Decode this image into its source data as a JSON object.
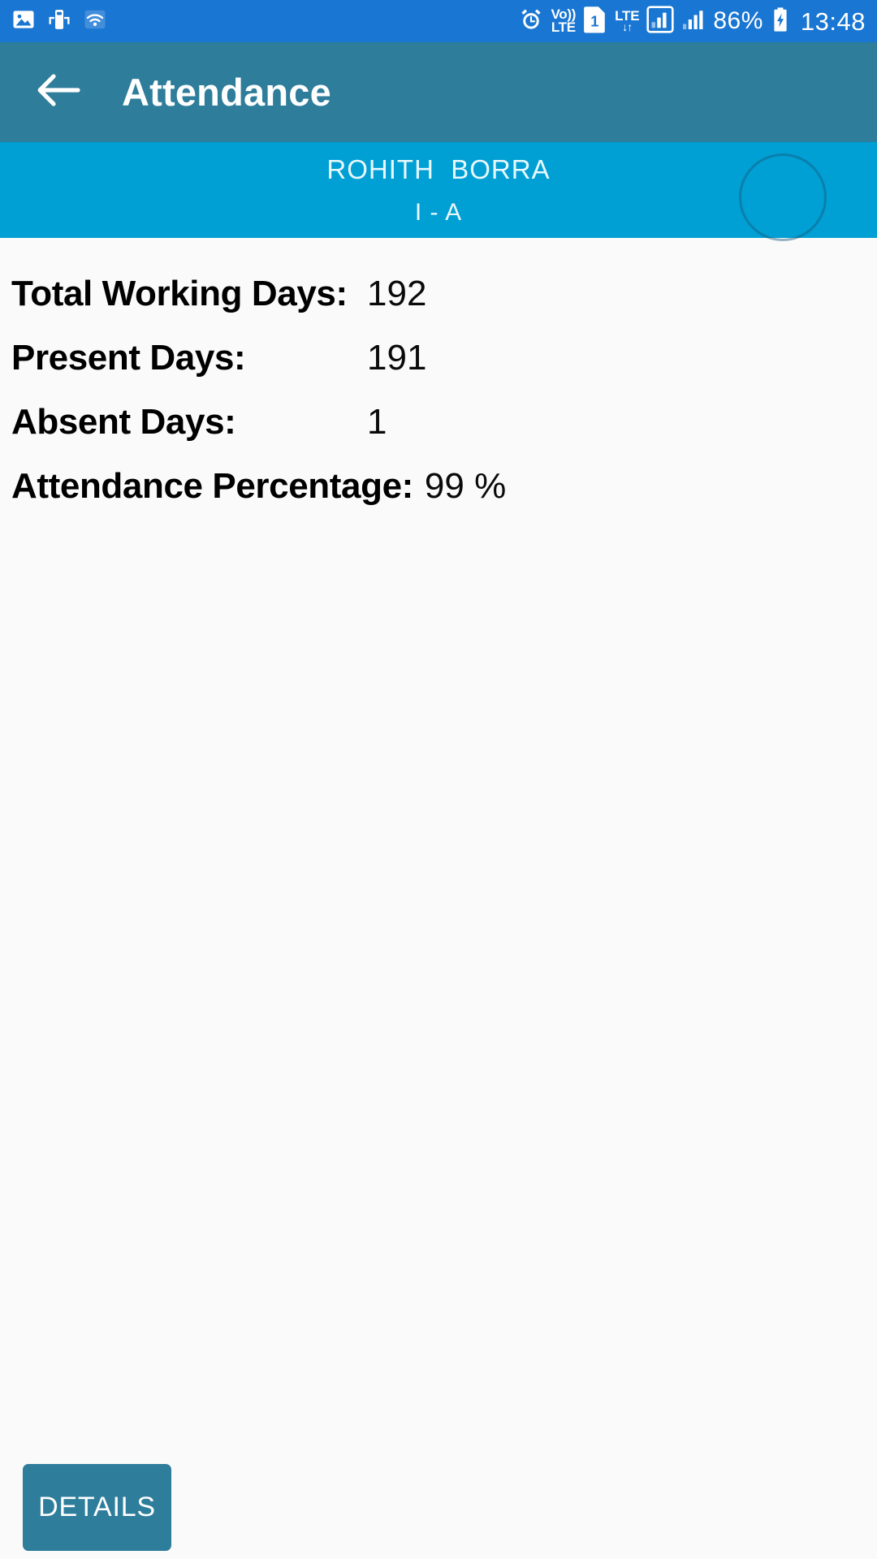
{
  "status_bar": {
    "background": "#1976D2",
    "left_icons": [
      {
        "name": "image-icon",
        "label": "Screenshot"
      },
      {
        "name": "cast-device-icon",
        "label": "Smart View"
      },
      {
        "name": "wifi-icon",
        "label": "Wi-Fi"
      }
    ],
    "alarm_icon": "alarm-icon",
    "volte": {
      "top": "Vo))",
      "bottom": "LTE"
    },
    "sim_badge": "1",
    "lte": {
      "label": "LTE",
      "arrows": "↓↑"
    },
    "signal_primary_icon": "signal-boxed-icon",
    "signal_secondary_icon": "signal-bars-icon",
    "battery_percent": "86%",
    "battery_icon": "battery-charging-icon",
    "clock": "13:48"
  },
  "app_bar": {
    "background": "#2E7D9B",
    "back_icon": "back-arrow-icon",
    "title": "Attendance"
  },
  "student_banner": {
    "background": "#009FD4",
    "name": "ROHITH  BORRA",
    "class": "I - A",
    "avatar_placeholder": "avatar-placeholder"
  },
  "attendance": {
    "rows": [
      {
        "label": "Total Working Days:",
        "value": "192",
        "align": "fixed"
      },
      {
        "label": "Present Days:",
        "value": "191",
        "align": "fixed"
      },
      {
        "label": "Absent Days:",
        "value": "1",
        "align": "fixed"
      },
      {
        "label": "Attendance Percentage:",
        "value": "99 %",
        "align": "inline"
      }
    ]
  },
  "footer": {
    "details_label": "DETAILS",
    "details_color": "#2E7D9B"
  }
}
